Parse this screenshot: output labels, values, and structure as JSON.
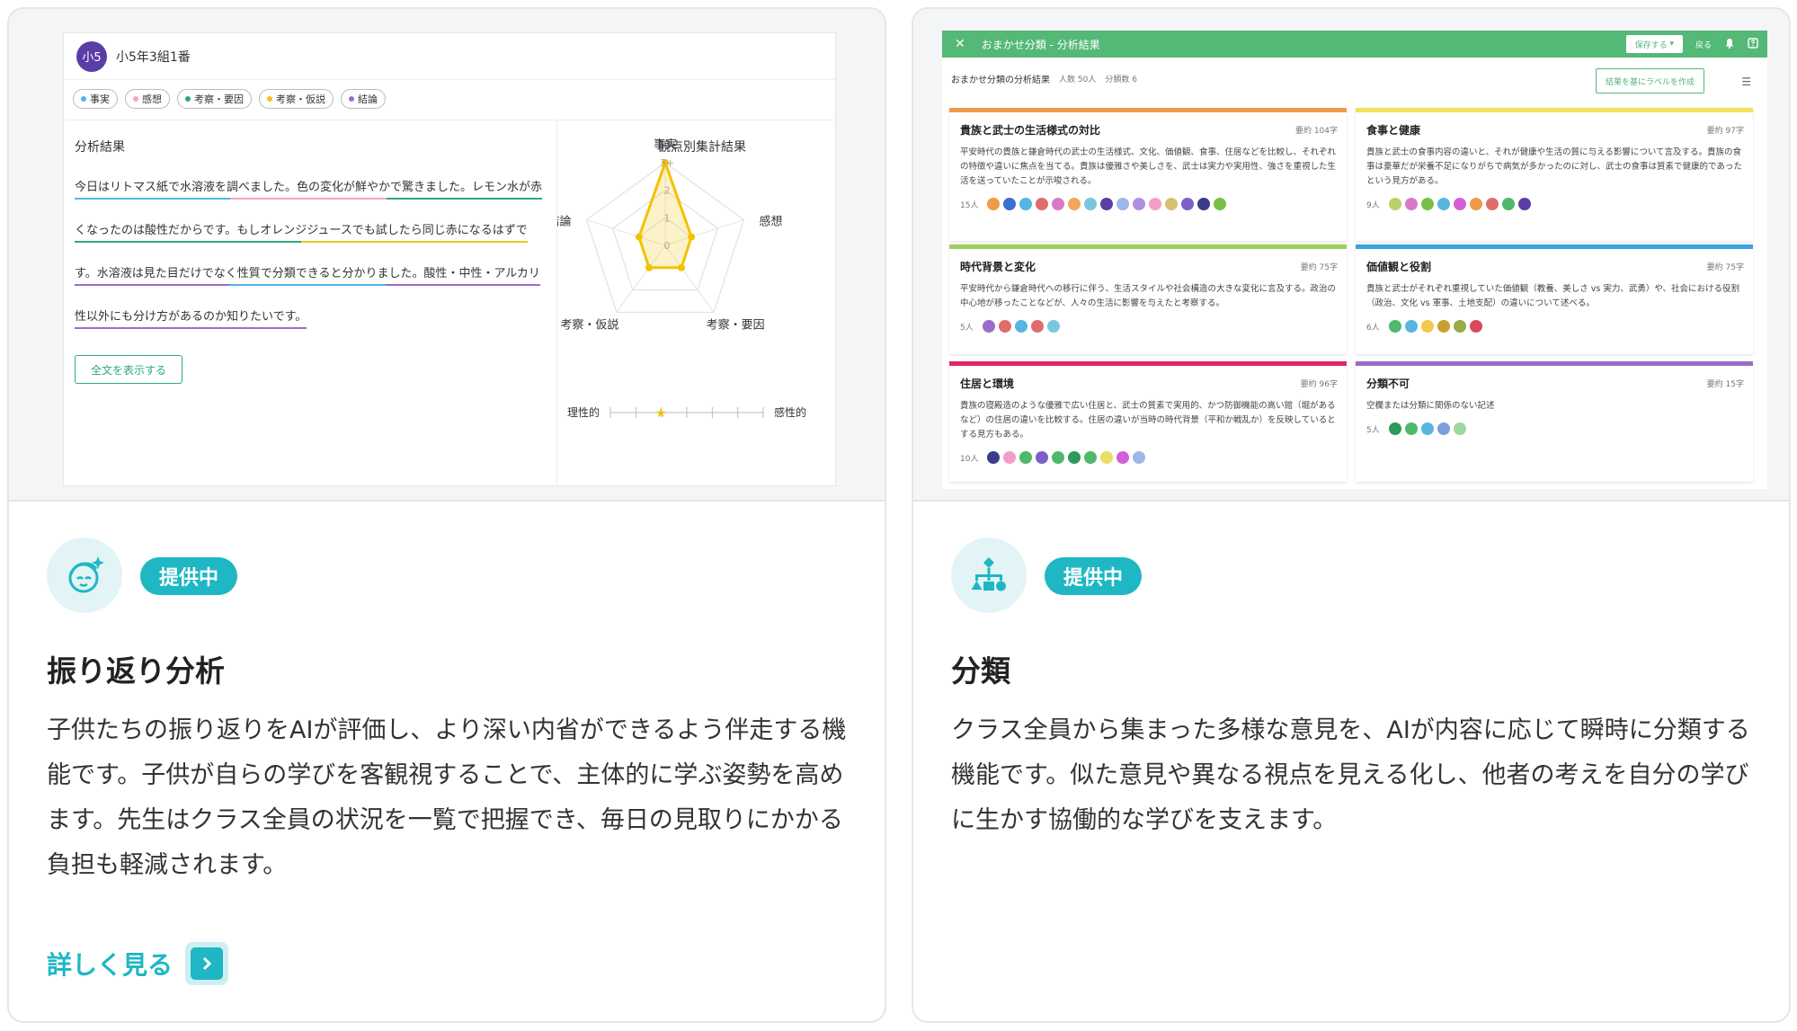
{
  "left": {
    "badge": "提供中",
    "title": "振り返り分析",
    "description": "子供たちの振り返りをAIが評価し、より深い内省ができるよう伴走する機能です。子供が自らの学びを客観視することで、主体的に学ぶ姿勢を高めます。先生はクラス全員の状況を一覧で把握でき、毎日の見取りにかかる負担も軽減されます。",
    "link": "詳しく見る",
    "icon": "child-sparkle-icon",
    "preview": {
      "avatar": "小5",
      "student": "小5年3組1番",
      "tags": [
        {
          "label": "事実",
          "color": "#4fb7e8"
        },
        {
          "label": "感想",
          "color": "#f2a6c4"
        },
        {
          "label": "考察・要因",
          "color": "#2eaa74"
        },
        {
          "label": "考察・仮説",
          "color": "#f0c419"
        },
        {
          "label": "結論",
          "color": "#9b6cc9"
        }
      ],
      "section_title": "分析結果",
      "lines": [
        "今日はリトマス紙で水溶液を調べました。色の変化が鮮やかで驚きました。レモン水が赤",
        "くなったのは酸性だからです。もしオレンジジュースでも試したら同じ赤になるはずで",
        "す。水溶液は見た目だけでなく性質で分類できると分かりました。酸性・中性・アルカリ",
        "性以外にも分け方があるのか知りたいです。"
      ],
      "show_all": "全文を表示する",
      "radar_title": "観点別集計結果",
      "radar_axes": [
        "事実",
        "感想",
        "考察・要因",
        "考察・仮説",
        "結論"
      ],
      "radar_ticks": [
        "3+",
        "2",
        "1",
        "0"
      ],
      "radar_values": [
        3,
        1,
        1,
        1,
        1
      ],
      "radar_max": 3,
      "scale_left": "理性的",
      "scale_right": "感性的",
      "scale_value": 0.33
    }
  },
  "right": {
    "badge": "提供中",
    "title": "分類",
    "description": "クラス全員から集まった多様な意見を、AIが内容に応じて瞬時に分類する機能です。似た意見や異なる視点を見える化し、他者の考えを自分の学びに生かす協働的な学びを支えます。",
    "icon": "hierarchy-icon",
    "preview": {
      "topbar_title": "おまかせ分類 - 分析結果",
      "save": "保存する",
      "back": "戻る",
      "sub_title": "おまかせ分類の分析結果",
      "sub_people": "人数 50人",
      "sub_count": "分類数 6",
      "create_btn": "結果を基にラベルを作成",
      "categories": [
        {
          "title": "貴族と武士の生活様式の対比",
          "count": "要約 104字",
          "color": "#f09a4a",
          "desc": "平安時代の貴族と鎌倉時代の武士の生活様式、文化、価値観、食事、住居などを比較し、それぞれの特徴や違いに焦点を当てる。貴族は優雅さや美しさを、武士は実力や実用性、強さを重視した生活を送っていたことが示唆される。",
          "people": "15人",
          "dots": [
            "#f09a4a",
            "#3b6fd1",
            "#58b5e0",
            "#e06c6c",
            "#d77bc8",
            "#f2a65a",
            "#7ac6e0",
            "#5b3ea5",
            "#9fb7e8",
            "#b48fe0",
            "#f0a0c8",
            "#d8c070",
            "#7a60c8",
            "#3b3b8e",
            "#7ac047"
          ]
        },
        {
          "title": "食事と健康",
          "count": "要約 97字",
          "color": "#f2e15a",
          "desc": "貴族と武士の食事内容の違いと、それが健康や生活の質に与える影響について言及する。貴族の食事は豪華だが栄養不足になりがちで病気が多かったのに対し、武士の食事は質素で健康的であったという見方がある。",
          "people": "9人",
          "dots": [
            "#b9d16a",
            "#d77bc8",
            "#7ac047",
            "#58b5e0",
            "#d25fd8",
            "#f09a4a",
            "#e06c6c",
            "#4fb86a",
            "#5b3ea5"
          ]
        },
        {
          "title": "時代背景と変化",
          "count": "要約 75字",
          "color": "#9ccf5a",
          "desc": "平安時代から鎌倉時代への移行に伴う、生活スタイルや社会構造の大きな変化に言及する。政治の中心地が移ったことなどが、人々の生活に影響を与えたと考察する。",
          "people": "5人",
          "dots": [
            "#9b6cc9",
            "#e06c6c",
            "#58b5e0",
            "#e06c6c",
            "#7ac6e0"
          ]
        },
        {
          "title": "価値観と役割",
          "count": "要約 75字",
          "color": "#3aa3e0",
          "desc": "貴族と武士がそれぞれ重視していた価値観（教養、美しさ vs 実力、武勇）や、社会における役割（政治、文化 vs 軍事、土地支配）の違いについて述べる。",
          "people": "6人",
          "dots": [
            "#4fb86a",
            "#58b5e0",
            "#f2c94c",
            "#c8a030",
            "#9bab4a",
            "#d94a5a"
          ]
        },
        {
          "title": "住居と環境",
          "count": "要約 96字",
          "color": "#e0266a",
          "desc": "貴族の寝殿造のような優雅で広い住居と、武士の質素で実用的、かつ防御機能の高い館（堀があるなど）の住居の違いを比較する。住居の違いが当時の時代背景（平和か戦乱か）を反映しているとする見方もある。",
          "people": "10人",
          "dots": [
            "#3b3b8e",
            "#f0a0c8",
            "#4fb86a",
            "#7a60c8",
            "#4fb86a",
            "#2e9a5a",
            "#4fb86a",
            "#e8e060",
            "#d25fd8",
            "#9fb7e8"
          ]
        },
        {
          "title": "分類不可",
          "count": "要約 15字",
          "color": "#9b6cc9",
          "desc": "空欄または分類に関係のない記述",
          "people": "5人",
          "dots": [
            "#2e9a5a",
            "#4fb86a",
            "#58b5e0",
            "#7aa0e0",
            "#9fd8a0"
          ]
        }
      ]
    }
  }
}
